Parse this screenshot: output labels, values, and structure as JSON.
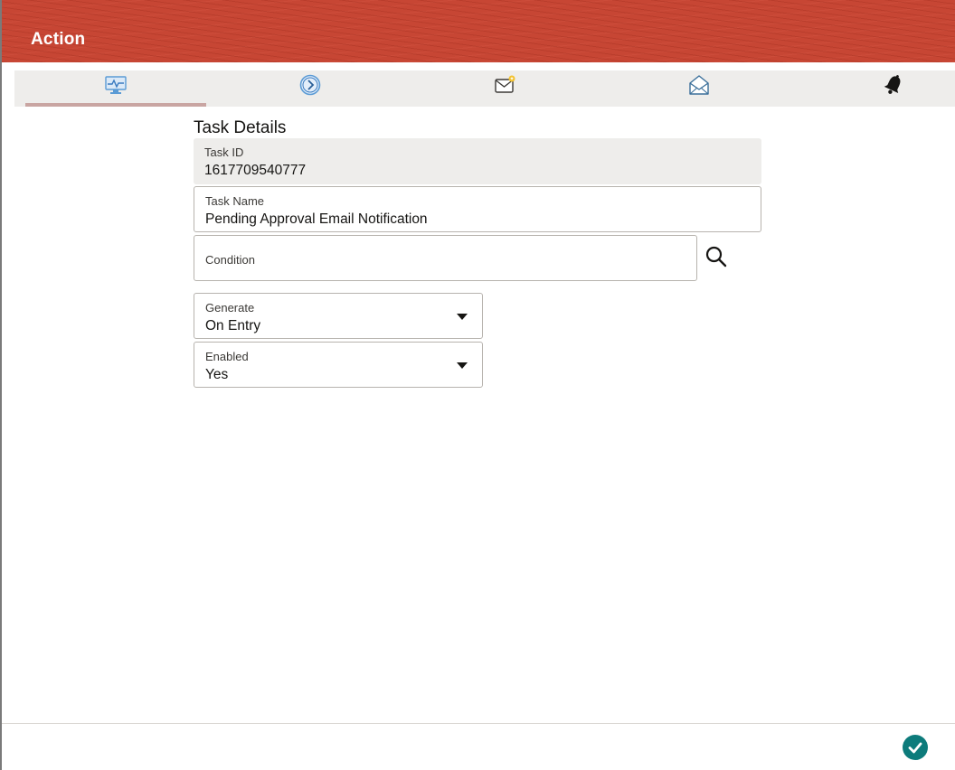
{
  "header": {
    "title": "Action"
  },
  "tabs": [
    {
      "icon": "monitor-activity-icon",
      "active": true
    },
    {
      "icon": "clock-arrow-icon",
      "active": false
    },
    {
      "icon": "mail-new-icon",
      "active": false
    },
    {
      "icon": "open-envelope-icon",
      "active": false
    },
    {
      "icon": "bell-icon",
      "active": false
    }
  ],
  "task_details": {
    "title": "Task Details",
    "task_id": {
      "label": "Task ID",
      "value": "1617709540777"
    },
    "task_name": {
      "label": "Task Name",
      "value": "Pending Approval Email Notification"
    },
    "condition": {
      "label": "Condition",
      "value": ""
    },
    "generate": {
      "label": "Generate",
      "value": "On Entry"
    },
    "enabled": {
      "label": "Enabled",
      "value": "Yes"
    }
  },
  "actions": {
    "search_icon": "search-icon",
    "ok_icon": "check-icon"
  },
  "colors": {
    "header": "#c74634",
    "tab_bar": "#eeedeb",
    "active_tab_indicator": "#c9a5a2",
    "ok_button": "#0d7b7b"
  }
}
